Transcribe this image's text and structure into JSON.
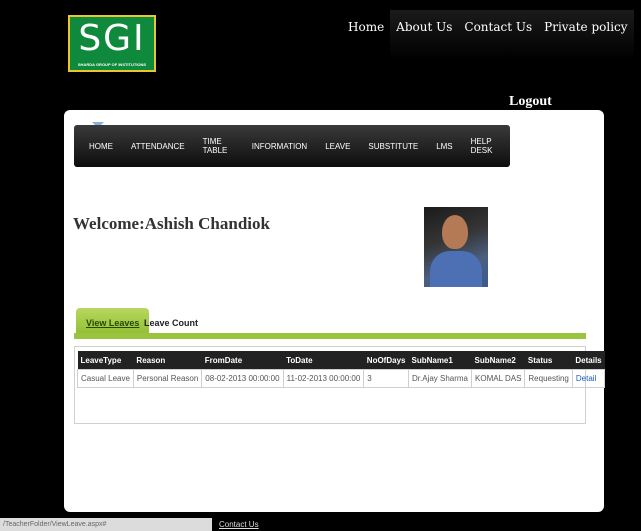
{
  "logo": {
    "big": "SGI",
    "small": "SHARDA GROUP OF INSTITUTIONS"
  },
  "top_nav": [
    "Home",
    "About Us",
    "Contact Us",
    "Private policy"
  ],
  "logout": "Logout",
  "main_nav": [
    "HOME",
    "ATTENDANCE",
    "TIME TABLE",
    "INFORMATION",
    "LEAVE",
    "SUBSTITUTE",
    "LMS",
    "HELP DESK"
  ],
  "welcome": "Welcome:Ashish Chandiok",
  "tabs": {
    "active": "View Leaves",
    "other": "Leave Count"
  },
  "table": {
    "headers": [
      "LeaveType",
      "Reason",
      "FromDate",
      "ToDate",
      "NoOfDays",
      "SubName1",
      "SubName2",
      "Status",
      "Details"
    ],
    "row": [
      "Casual Leave",
      "Personal Reason",
      "08-02-2013 00:00:00",
      "11-02-2013 00:00:00",
      "3",
      "Dr.Ajay Sharma",
      "KOMAL DAS",
      "Requesting",
      "Detail"
    ]
  },
  "statusbar": "/TeacherFolder/ViewLeave.aspx#",
  "footer_link": "Contact Us"
}
